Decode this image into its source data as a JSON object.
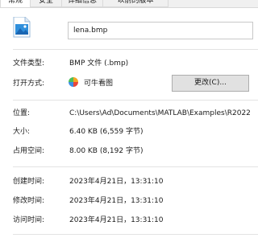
{
  "tabs": [
    "常规",
    "安全",
    "详细信息",
    "以前的版本"
  ],
  "file": {
    "name": "lena.bmp",
    "icon": "image-file-icon"
  },
  "rows": {
    "type_label": "文件类型:",
    "type_value": "BMP 文件 (.bmp)",
    "open_label": "打开方式:",
    "open_app": "可牛看图",
    "open_app_icon": "pinwheel-app-icon",
    "change_button": "更改(C)...",
    "location_label": "位置:",
    "location_value": "C:\\Users\\Ad\\Documents\\MATLAB\\Examples\\R2022",
    "size_label": "大小:",
    "size_value": "6.40 KB (6,559 字节)",
    "disk_label": "占用空间:",
    "disk_value": "8.00 KB (8,192 字节)",
    "created_label": "创建时间:",
    "created_value": "2023年4月21日，13:31:10",
    "modified_label": "修改时间:",
    "modified_value": "2023年4月21日，13:31:10",
    "accessed_label": "访问时间:",
    "accessed_value": "2023年4月21日，13:31:10"
  }
}
